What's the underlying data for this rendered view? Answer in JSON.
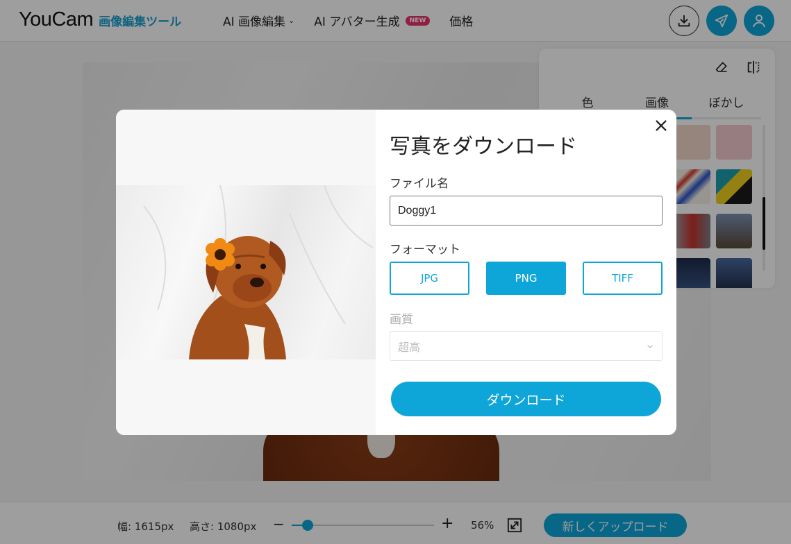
{
  "header": {
    "logo_main": "YouCam",
    "logo_sub": "画像編集ツール",
    "nav": [
      {
        "label": "AI 画像編集",
        "has_dropdown": true
      },
      {
        "label": "AI アバター生成",
        "badge": "NEW"
      },
      {
        "label": "価格"
      }
    ]
  },
  "panel": {
    "tabs": [
      "色",
      "画像",
      "ぼかし"
    ],
    "active_tab": 1
  },
  "bottombar": {
    "width_label": "幅: 1615px",
    "height_label": "高さ: 1080px",
    "minus": "−",
    "plus": "+",
    "zoom": 56,
    "zoom_label": "56%",
    "upload_label": "新しくアップロード"
  },
  "modal": {
    "title": "写真をダウンロード",
    "filename_label": "ファイル名",
    "filename_value": "Doggy1",
    "format_label": "フォーマット",
    "formats": [
      "JPG",
      "PNG",
      "TIFF"
    ],
    "selected_format": "PNG",
    "quality_label": "画質",
    "quality_value": "超高",
    "download_label": "ダウンロード"
  },
  "colors": {
    "accent": "#0ea5d8",
    "badge": "#e8356d",
    "dog": "#a24f1c",
    "flower": "#f08a14"
  }
}
